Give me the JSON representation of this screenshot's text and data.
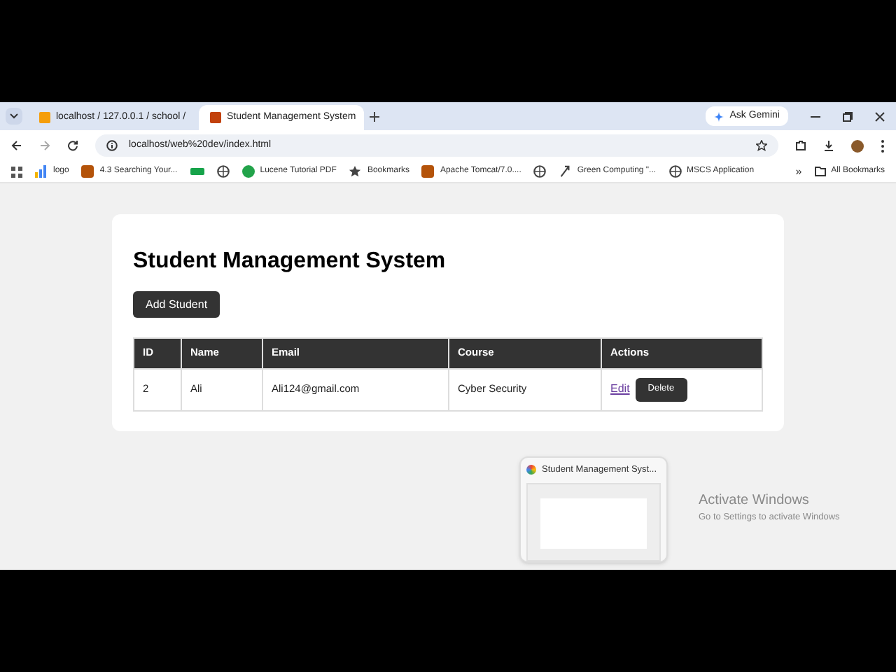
{
  "tabs": [
    {
      "title": "localhost / 127.0.0.1 / school / ",
      "selected": false
    },
    {
      "title": "Student Management System",
      "selected": true
    }
  ],
  "ask_gemini": "Ask Gemini",
  "address": "localhost/web%20dev/index.html",
  "bookmarks": [
    {
      "kind": "bars",
      "label": "logo"
    },
    {
      "kind": "badge",
      "label": "4.3 Searching Your..."
    },
    {
      "kind": "chip"
    },
    {
      "kind": "globe"
    },
    {
      "kind": "circle",
      "label": "Lucene Tutorial PDF"
    },
    {
      "kind": "star",
      "label": "Bookmarks"
    },
    {
      "kind": "badge",
      "label": "Apache Tomcat/7.0...."
    },
    {
      "kind": "globe"
    },
    {
      "kind": "leaf",
      "label": "Green Computing \"..."
    },
    {
      "kind": "globe",
      "label": "MSCS Application"
    }
  ],
  "overflow": "»",
  "all_bookmarks": "All Bookmarks",
  "page": {
    "heading": "Student Management System",
    "add_button": "Add Student",
    "columns": [
      "ID",
      "Name",
      "Email",
      "Course",
      "Actions"
    ],
    "rows": [
      {
        "id": "2",
        "name": "Ali",
        "email": "Ali124@gmail.com",
        "course": "Cyber Security",
        "edit": "Edit",
        "delete": "Delete"
      }
    ]
  },
  "preview": {
    "title": "Student Management Syst..."
  },
  "activation": {
    "title": "Activate Windows",
    "subtitle": "Go to Settings to activate Windows"
  }
}
